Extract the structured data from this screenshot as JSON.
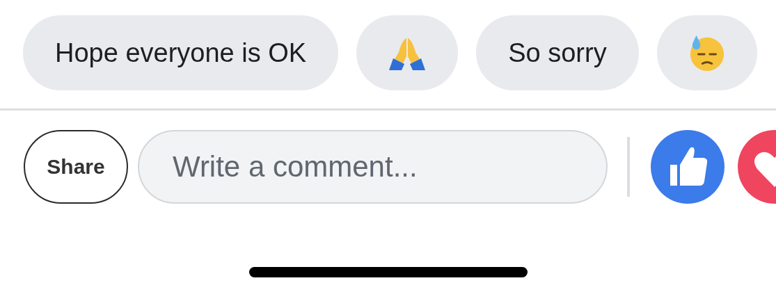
{
  "quick_replies": [
    {
      "kind": "text",
      "label": "Hope everyone is OK"
    },
    {
      "kind": "hands"
    },
    {
      "kind": "text",
      "label": "So sorry"
    },
    {
      "kind": "face"
    }
  ],
  "share_button": "Share",
  "comment_field": {
    "placeholder": "Write a comment..."
  },
  "reactions": [
    {
      "kind": "like"
    },
    {
      "kind": "love"
    }
  ]
}
